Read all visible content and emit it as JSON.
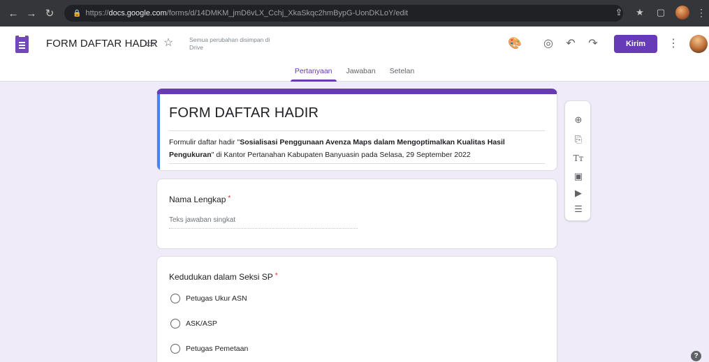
{
  "browser": {
    "url_prefix": "https://",
    "url_domain": "docs.google.com",
    "url_path": "/forms/d/14DMKM_jmD6vLX_Cchj_XkaSkqc2hmBypG-UonDKLoY/edit",
    "icons": [
      "back-icon",
      "forward-icon",
      "reload-icon",
      "lock-icon",
      "share-icon",
      "bookmark-star-icon",
      "window-icon",
      "profile-avatar",
      "chrome-menu-icon"
    ]
  },
  "header": {
    "title": "FORM DAFTAR HADIR",
    "save_status": "Semua perubahan disimpan di Drive",
    "send_label": "Kirim",
    "icons": [
      "palette-icon",
      "preview-eye-icon",
      "undo-icon",
      "redo-icon",
      "more-vert-icon"
    ]
  },
  "tabs": [
    {
      "label": "Pertanyaan",
      "active": true
    },
    {
      "label": "Jawaban",
      "active": false
    },
    {
      "label": "Setelan",
      "active": false
    }
  ],
  "form": {
    "title": "FORM DAFTAR HADIR",
    "desc_prefix": "Formulir daftar hadir \"",
    "desc_bold": "Sosialisasi Penggunaan Avenza Maps dalam Mengoptimalkan Kualitas Hasil Pengukuran",
    "desc_suffix": "\" di Kantor Pertanahan Kabupaten Banyuasin pada Selasa, 29 September 2022"
  },
  "questions": [
    {
      "title": "Nama Lengkap",
      "required_mark": "*",
      "placeholder": "Teks jawaban singkat"
    },
    {
      "title": "Kedudukan dalam Seksi SP",
      "required_mark": "*",
      "options": [
        "Petugas Ukur ASN",
        "ASK/ASP",
        "Petugas Pemetaan"
      ]
    }
  ],
  "toolbar": [
    "add-question-icon",
    "import-questions-icon",
    "add-title-icon",
    "add-image-icon",
    "add-video-icon",
    "add-section-icon"
  ],
  "colors": {
    "accent": "#673ab7",
    "background": "#f0ebf8",
    "focus": "#4285f4"
  },
  "help_label": "?"
}
